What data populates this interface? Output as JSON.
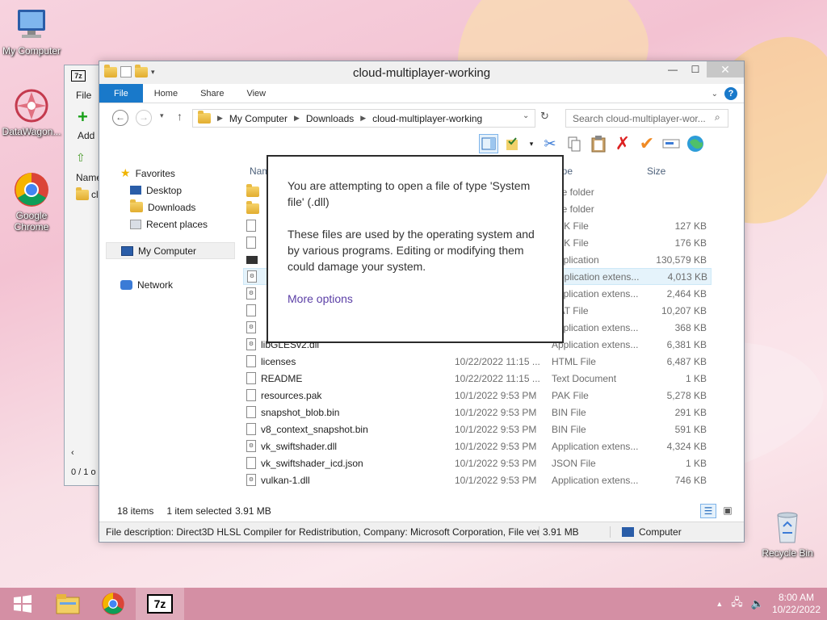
{
  "desktop": {
    "icons": [
      {
        "label": "My Computer"
      },
      {
        "label": "DataWagon..."
      },
      {
        "label": "Google Chrome"
      },
      {
        "label": "Recycle Bin"
      }
    ]
  },
  "bg7z": {
    "menu_file": "File",
    "add_label": "Add",
    "col_name": "Name",
    "row_text": "clo",
    "status": "0 / 1 o"
  },
  "explorer": {
    "title": "cloud-multiplayer-working",
    "tabs": [
      "File",
      "Home",
      "Share",
      "View"
    ],
    "address": {
      "crumbs": [
        "My Computer",
        "Downloads",
        "cloud-multiplayer-working"
      ]
    },
    "search_placeholder": "Search cloud-multiplayer-wor...",
    "nav": {
      "favorites": "Favorites",
      "desktop": "Desktop",
      "downloads": "Downloads",
      "recent": "Recent places",
      "my_computer": "My Computer",
      "network": "Network"
    },
    "columns": {
      "name": "Name",
      "type": "Type",
      "size": "Size"
    },
    "files": [
      {
        "name": "",
        "date": "",
        "type": "File folder",
        "size": ""
      },
      {
        "name": "",
        "date": "",
        "type": "File folder",
        "size": ""
      },
      {
        "name": "",
        "date": "",
        "type": "PAK File",
        "size": "127 KB"
      },
      {
        "name": "",
        "date": "",
        "type": "PAK File",
        "size": "176 KB"
      },
      {
        "name": "",
        "date": "",
        "type": "Application",
        "size": "130,579 KB"
      },
      {
        "name": "",
        "date": "",
        "type": "Application extens...",
        "size": "4,013 KB"
      },
      {
        "name": "",
        "date": "",
        "type": "Application extens...",
        "size": "2,464 KB"
      },
      {
        "name": "",
        "date": "",
        "type": "DAT File",
        "size": "10,207 KB"
      },
      {
        "name": "",
        "date": "",
        "type": "Application extens...",
        "size": "368 KB"
      },
      {
        "name": "libGLESv2.dll",
        "date": "",
        "type": "Application extens...",
        "size": "6,381 KB"
      },
      {
        "name": "licenses",
        "date": "10/22/2022 11:15 ...",
        "type": "HTML File",
        "size": "6,487 KB"
      },
      {
        "name": "README",
        "date": "10/22/2022 11:15 ...",
        "type": "Text Document",
        "size": "1 KB"
      },
      {
        "name": "resources.pak",
        "date": "10/1/2022 9:53 PM",
        "type": "PAK File",
        "size": "5,278 KB"
      },
      {
        "name": "snapshot_blob.bin",
        "date": "10/1/2022 9:53 PM",
        "type": "BIN File",
        "size": "291 KB"
      },
      {
        "name": "v8_context_snapshot.bin",
        "date": "10/1/2022 9:53 PM",
        "type": "BIN File",
        "size": "591 KB"
      },
      {
        "name": "vk_swiftshader.dll",
        "date": "10/1/2022 9:53 PM",
        "type": "Application extens...",
        "size": "4,324 KB"
      },
      {
        "name": "vk_swiftshader_icd.json",
        "date": "10/1/2022 9:53 PM",
        "type": "JSON File",
        "size": "1 KB"
      },
      {
        "name": "vulkan-1.dll",
        "date": "10/1/2022 9:53 PM",
        "type": "Application extens...",
        "size": "746 KB"
      }
    ],
    "status": {
      "count": "18 items",
      "selected": "1 item selected",
      "sel_size": "3.91 MB"
    },
    "details": {
      "description": "File description: Direct3D HLSL Compiler for Redistribution, Company: Microsoft Corporation, File versi",
      "size": "3.91 MB",
      "location": "Computer"
    }
  },
  "dialog": {
    "line1": "You are attempting to open a file of type 'System file' (.dll)",
    "line2": "These files are used by the operating system and by various programs. Editing or modifying them could damage your system.",
    "more": "More options"
  },
  "taskbar": {
    "time": "8:00 AM",
    "date": "10/22/2022",
    "sevenzip": "7z"
  },
  "colors": {
    "accent": "#1979ca",
    "taskbar": "#d48fa4",
    "link": "#5b3fa6"
  }
}
